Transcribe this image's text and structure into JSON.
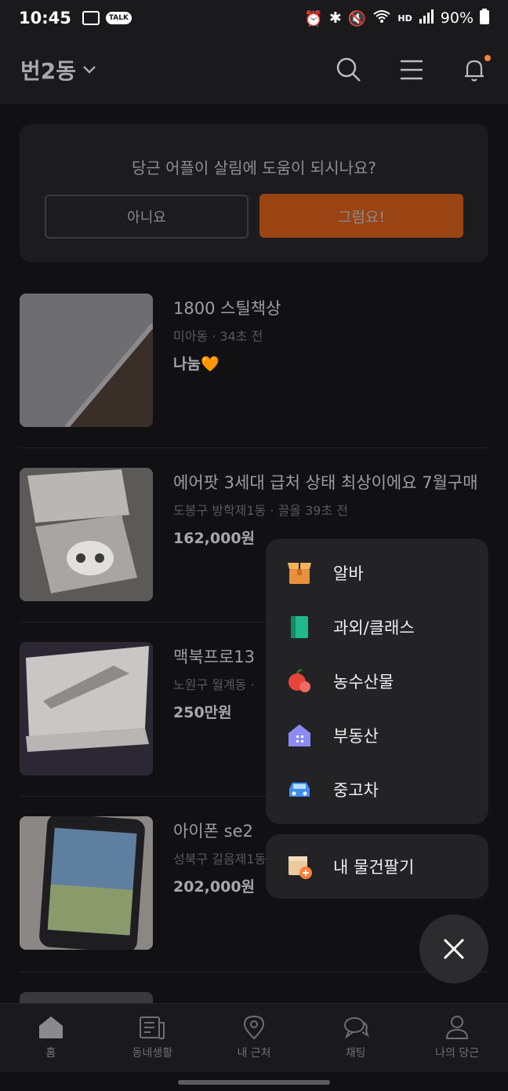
{
  "status_bar": {
    "time": "10:45",
    "talk_badge": "TALK",
    "hd_label": "HD",
    "battery": "90%"
  },
  "header": {
    "location": "번2동"
  },
  "survey": {
    "question": "당근 어플이 살림에 도움이 되시나요?",
    "no_label": "아니요",
    "yes_label": "그럼요!"
  },
  "listings": [
    {
      "title": "1800 스틸책상",
      "meta": "미아동 · 34초 전",
      "price": "나눔🧡"
    },
    {
      "title": "에어팟 3세대 급처 상태 최상이에요 7월구매",
      "meta": "도봉구 방학제1동 · 끌올 39초 전",
      "price": "162,000원"
    },
    {
      "title": "맥북프로13",
      "meta": "노원구 월계동 ·",
      "price": "250만원"
    },
    {
      "title": "아이폰 se2",
      "meta": "성북구 길음제1동",
      "price": "202,000원"
    }
  ],
  "menu": {
    "items": [
      {
        "label": "알바",
        "icon": "box-icon"
      },
      {
        "label": "과외/클래스",
        "icon": "book-icon"
      },
      {
        "label": "농수산물",
        "icon": "apple-icon"
      },
      {
        "label": "부동산",
        "icon": "house-icon"
      },
      {
        "label": "중고차",
        "icon": "car-icon"
      }
    ],
    "sell_label": "내 물건팔기"
  },
  "bottom_nav": [
    {
      "label": "홈",
      "icon": "home-icon"
    },
    {
      "label": "동네생활",
      "icon": "newspaper-icon"
    },
    {
      "label": "내 근처",
      "icon": "location-pin-icon"
    },
    {
      "label": "채팅",
      "icon": "chat-bubble-icon"
    },
    {
      "label": "나의 당근",
      "icon": "person-icon"
    }
  ],
  "colors": {
    "accent": "#ff7e36",
    "background": "#111113",
    "card": "#1c1c1f",
    "menu": "#232326"
  }
}
